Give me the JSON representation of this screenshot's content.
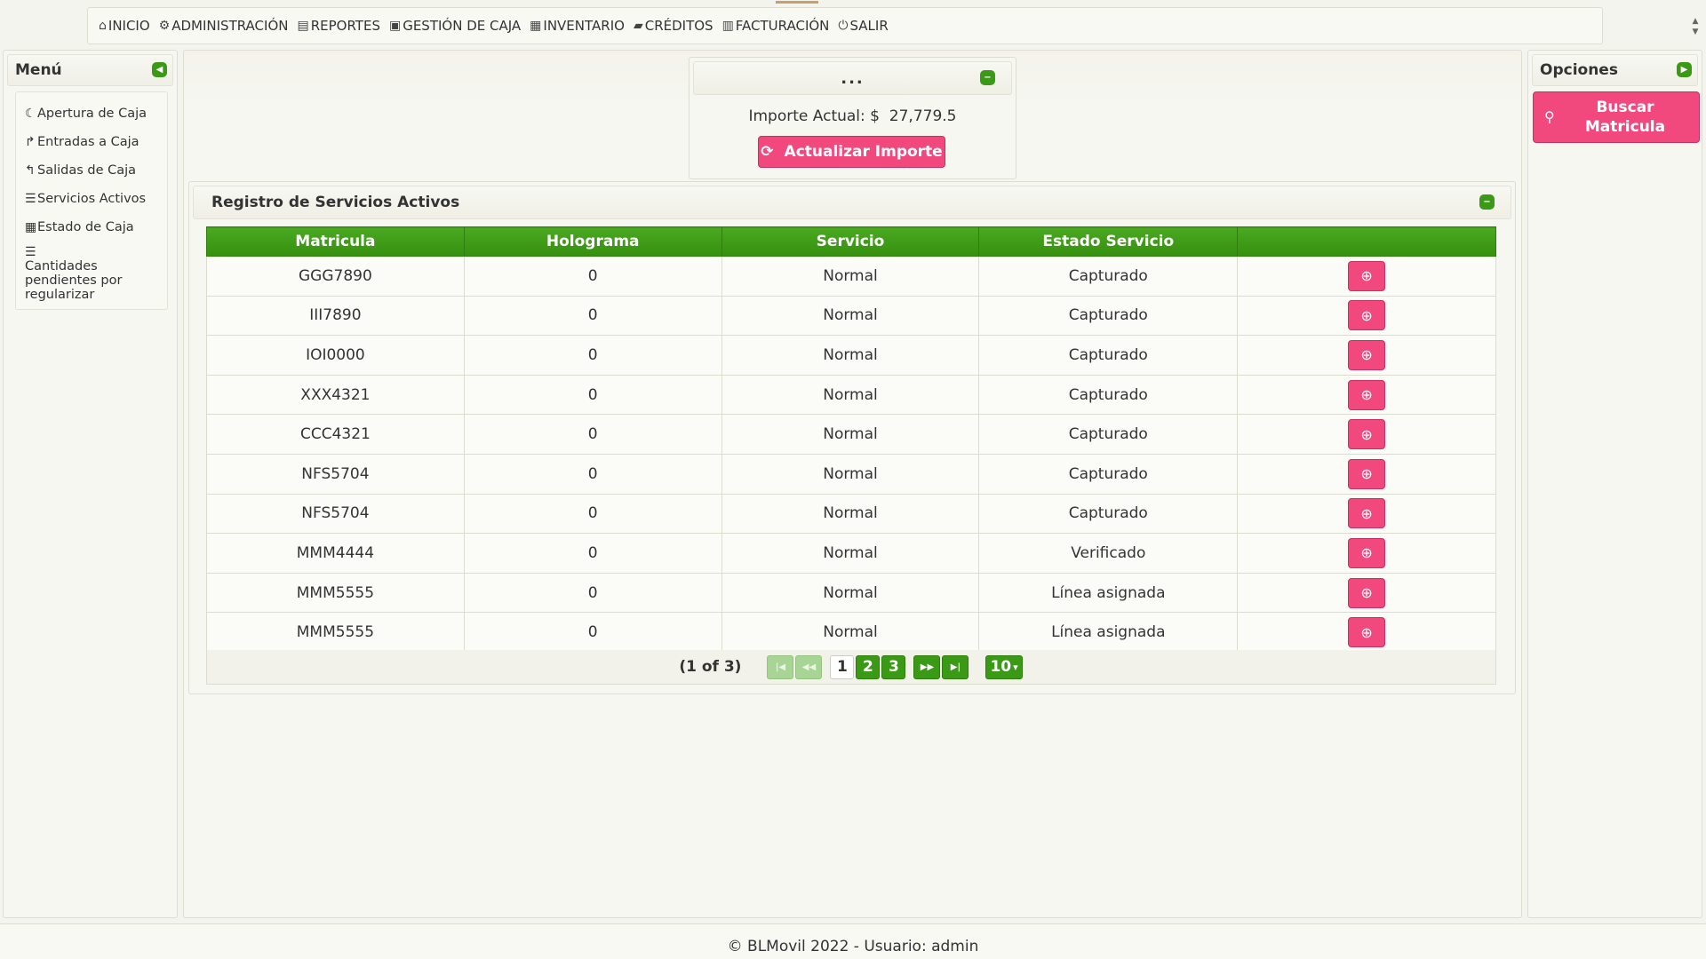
{
  "nav": [
    {
      "icon": "home-icon",
      "glyph": "⌂",
      "label": "INICIO"
    },
    {
      "icon": "gears-icon",
      "glyph": "⚙",
      "label": "ADMINISTRACIÓN"
    },
    {
      "icon": "file-icon",
      "glyph": "▤",
      "label": "REPORTES"
    },
    {
      "icon": "money-icon",
      "glyph": "▣",
      "label": "GESTIÓN DE CAJA"
    },
    {
      "icon": "list-alt-icon",
      "glyph": "▦",
      "label": "INVENTARIO"
    },
    {
      "icon": "book-icon",
      "glyph": "▰",
      "label": "CRÉDITOS"
    },
    {
      "icon": "barcode-icon",
      "glyph": "▥",
      "label": "FACTURACIÓN"
    },
    {
      "icon": "power-icon",
      "glyph": "⏻",
      "label": "SALIR"
    }
  ],
  "menu": {
    "title": "Menú",
    "items": [
      {
        "label": "Apertura de Caja"
      },
      {
        "label": "Entradas a Caja"
      },
      {
        "label": "Salidas de Caja"
      },
      {
        "label": "Servicios Activos"
      },
      {
        "label": "Estado de Caja"
      },
      {
        "label": "Cantidades pendientes por regularizar"
      }
    ]
  },
  "options": {
    "title": "Opciones",
    "search_button": "Buscar Matricula"
  },
  "importe": {
    "header": "...",
    "label": "Importe Actual: $",
    "value": "27,779.5",
    "button": "Actualizar Importe"
  },
  "registro": {
    "title": "Registro de Servicios Activos",
    "columns": [
      "Matricula",
      "Holograma",
      "Servicio",
      "Estado Servicio",
      ""
    ],
    "rows": [
      {
        "matricula": "GGG7890",
        "holograma": "0",
        "servicio": "Normal",
        "estado": "Capturado"
      },
      {
        "matricula": "III7890",
        "holograma": "0",
        "servicio": "Normal",
        "estado": "Capturado"
      },
      {
        "matricula": "IOI0000",
        "holograma": "0",
        "servicio": "Normal",
        "estado": "Capturado"
      },
      {
        "matricula": "XXX4321",
        "holograma": "0",
        "servicio": "Normal",
        "estado": "Capturado"
      },
      {
        "matricula": "CCC4321",
        "holograma": "0",
        "servicio": "Normal",
        "estado": "Capturado"
      },
      {
        "matricula": "NFS5704",
        "holograma": "0",
        "servicio": "Normal",
        "estado": "Capturado"
      },
      {
        "matricula": "NFS5704",
        "holograma": "0",
        "servicio": "Normal",
        "estado": "Capturado"
      },
      {
        "matricula": "MMM4444",
        "holograma": "0",
        "servicio": "Normal",
        "estado": "Verificado"
      },
      {
        "matricula": "MMM5555",
        "holograma": "0",
        "servicio": "Normal",
        "estado": "Línea asignada"
      },
      {
        "matricula": "MMM5555",
        "holograma": "0",
        "servicio": "Normal",
        "estado": "Línea asignada"
      }
    ],
    "pager": {
      "summary": "(1 of 3)",
      "pages": [
        "1",
        "2",
        "3"
      ],
      "rows_per_page": "10"
    }
  },
  "footer": "© BLMovil 2022 - Usuario: admin",
  "colors": {
    "accent_green": "#3a9a16",
    "accent_pink": "#f1487e"
  }
}
